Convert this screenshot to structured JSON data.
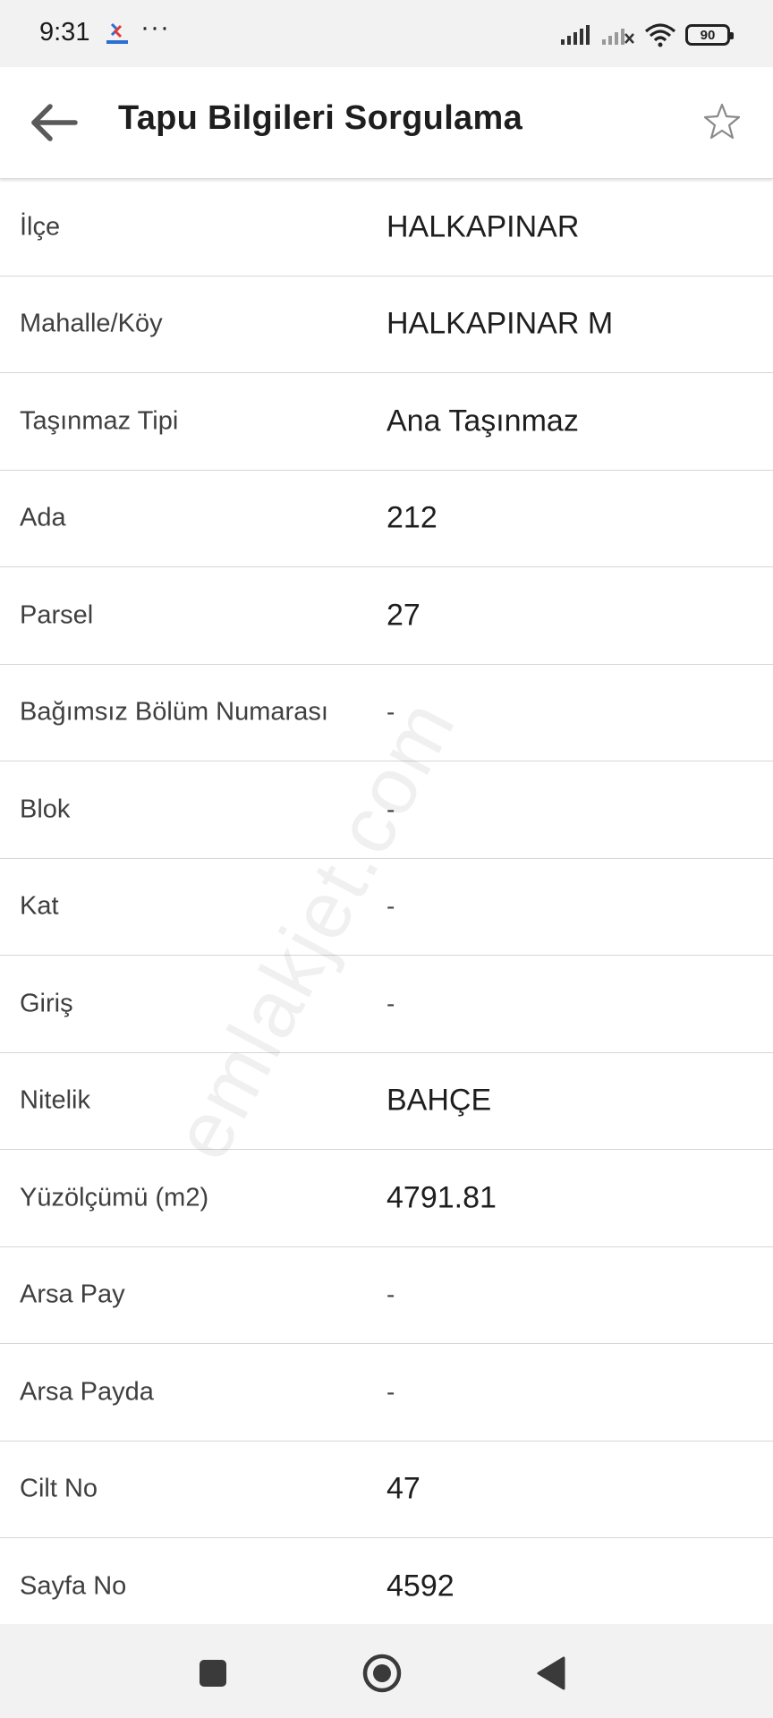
{
  "status_bar": {
    "time": "9:31",
    "dots": "···",
    "battery": "90",
    "icons": [
      "app-notification-icon",
      "signal-icon",
      "signal-no-service-icon",
      "wifi-icon",
      "battery-icon"
    ]
  },
  "app_bar": {
    "title": "Tapu Bilgileri Sorgulama",
    "icons": [
      "back-arrow-icon",
      "star-outline-icon"
    ]
  },
  "rows": [
    {
      "label": "İlçe",
      "value": "HALKAPINAR"
    },
    {
      "label": "Mahalle/Köy",
      "value": "HALKAPINAR M"
    },
    {
      "label": "Taşınmaz Tipi",
      "value": "Ana Taşınmaz"
    },
    {
      "label": "Ada",
      "value": "212"
    },
    {
      "label": "Parsel",
      "value": "27"
    },
    {
      "label": "Bağımsız Bölüm Numarası",
      "value": "-"
    },
    {
      "label": "Blok",
      "value": "-"
    },
    {
      "label": "Kat",
      "value": "-"
    },
    {
      "label": "Giriş",
      "value": "-"
    },
    {
      "label": "Nitelik",
      "value": "BAHÇE"
    },
    {
      "label": "Yüzölçümü (m2)",
      "value": "4791.81"
    },
    {
      "label": "Arsa Pay",
      "value": "-"
    },
    {
      "label": "Arsa Payda",
      "value": "-"
    },
    {
      "label": "Cilt No",
      "value": "47"
    },
    {
      "label": "Sayfa No",
      "value": "4592"
    }
  ],
  "watermark": "emlakjet.com",
  "nav_bar": {
    "icons": [
      "recent-apps-icon",
      "home-icon",
      "back-triangle-icon"
    ]
  },
  "colors": {
    "background": "#ffffff",
    "bars": "#f2f2f2",
    "divider": "#d6d6d6",
    "text": "#1e1e1e"
  }
}
